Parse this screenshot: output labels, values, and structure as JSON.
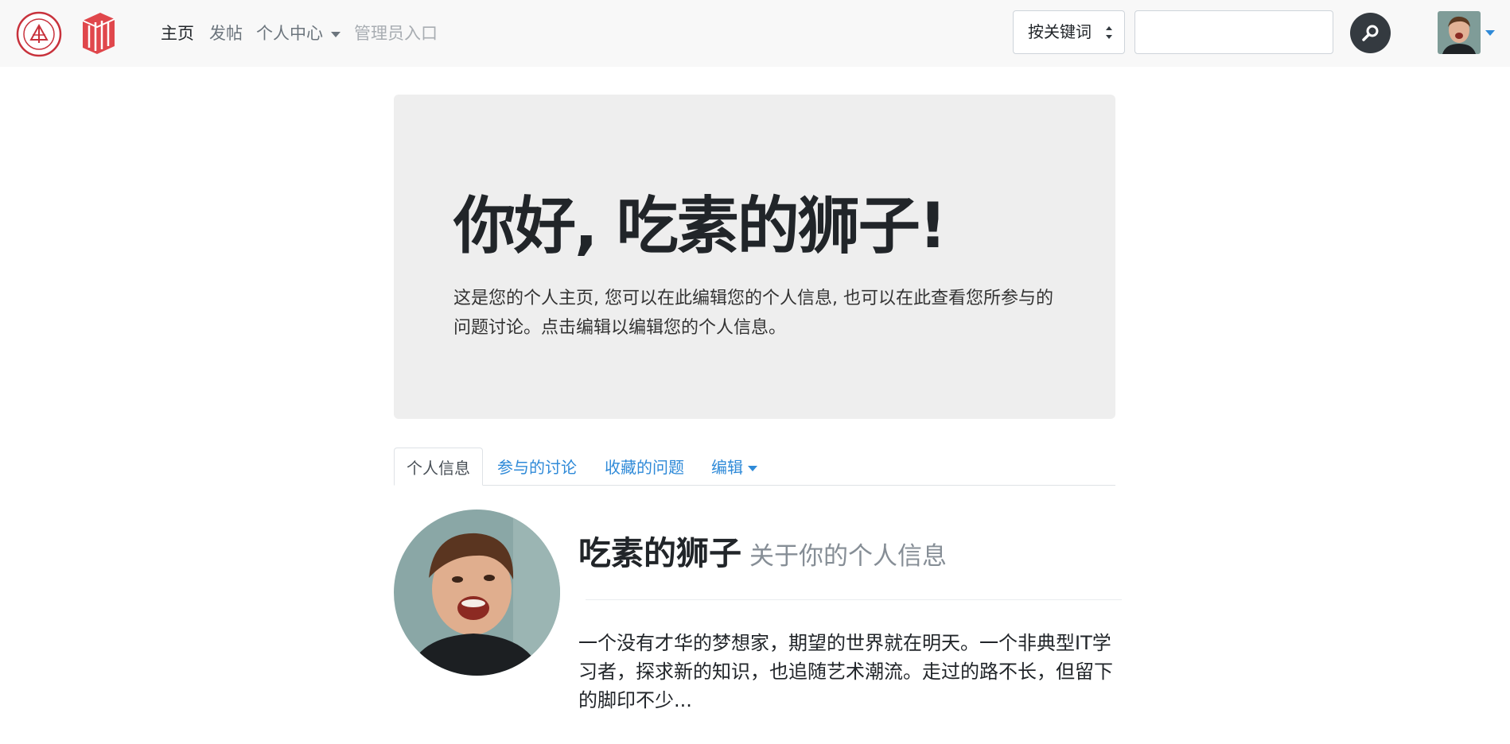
{
  "navbar": {
    "links": [
      "主页",
      "发帖",
      "个人中心",
      "管理员入口"
    ],
    "search": {
      "select_value": "按关键词",
      "input_value": "",
      "placeholder": ""
    },
    "accent_color": "#2f8ad8"
  },
  "jumbotron": {
    "title": "你好, 吃素的狮子!",
    "text": "这是您的个人主页, 您可以在此编辑您的个人信息, 也可以在此查看您所参与的问题讨论。点击编辑以编辑您的个人信息。"
  },
  "tabs": [
    "个人信息",
    "参与的讨论",
    "收藏的问题",
    "编辑"
  ],
  "profile": {
    "name": "吃素的狮子",
    "subtitle": "关于你的个人信息",
    "bio": "一个没有才华的梦想家，期望的世界就在明天。一个非典型IT学习者，探求新的知识，也追随艺术潮流。走过的路不长，但留下的脚印不少..."
  }
}
